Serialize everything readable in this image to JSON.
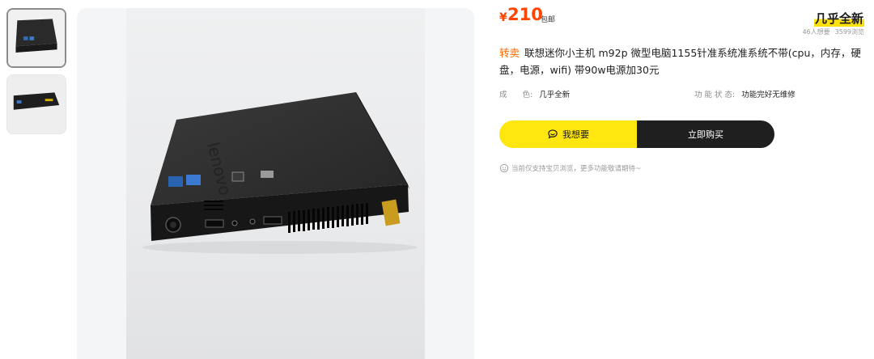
{
  "thumbnails": [
    {
      "label": "thumbnail-1",
      "active": true
    },
    {
      "label": "thumbnail-2",
      "active": false
    }
  ],
  "price": {
    "symbol": "¥",
    "value": "210",
    "free_shipping": "包邮"
  },
  "condition_badge": "几乎全新",
  "stats": {
    "wants": "46人想要",
    "views": "3599浏览"
  },
  "title": {
    "tag": "转卖",
    "text": "联想迷你小主机 m92p 微型电脑1155针准系统准系统不带(cpu，内存，硬盘，电源，wifi) 带90w电源加30元"
  },
  "attributes": [
    {
      "key": "成　　色:",
      "value": "几乎全新"
    },
    {
      "key": "功 能 状 态:",
      "value": "功能完好无维修"
    }
  ],
  "buttons": {
    "want": "我想要",
    "buy": "立即购买"
  },
  "notice": "当前仅支持宝贝浏览，更多功能敬请期待~",
  "icons": {
    "want": "chat-bubble-icon",
    "notice": "smiley-icon"
  },
  "colors": {
    "accent_yellow": "#ffe60f",
    "price_orange": "#ff4400",
    "tag_orange": "#ff6a00",
    "buy_black": "#1f1f1f"
  }
}
